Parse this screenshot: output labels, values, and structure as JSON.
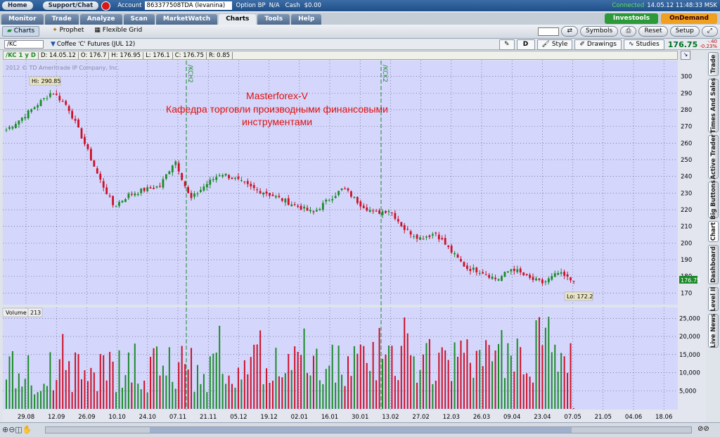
{
  "topbar": {
    "home": "Home",
    "support": "Support/Chat",
    "account_label": "Account",
    "account_value": "863377508TDA (levanina)",
    "option_bp_label": "Option BP",
    "option_bp_value": "N/A",
    "cash_label": "Cash",
    "cash_value": "$0.00",
    "connection_status": "Connected",
    "clock": "14.05.12 11:48:33 MSK"
  },
  "tabs": [
    "Monitor",
    "Trade",
    "Analyze",
    "Scan",
    "MarketWatch",
    "Charts",
    "Tools",
    "Help"
  ],
  "active_tab": "Charts",
  "badges": {
    "investools": "Investools",
    "ondemand": "OnDemand"
  },
  "subbar": {
    "charts": "Charts",
    "prophet": "Prophet",
    "flexible_grid": "Flexible Grid",
    "symbols": "Symbols",
    "reset": "Reset",
    "setup": "Setup"
  },
  "symbol_row": {
    "symbol": "/KC",
    "description": "Coffee 'C' Futures (JUL 12)",
    "d_button": "D",
    "style": "Style",
    "drawings": "Drawings",
    "studies": "Studies",
    "last_price": "176.75",
    "change": "-.40",
    "change_pct": "-0.23%"
  },
  "info_row": {
    "symbol": "/KC 1 y D",
    "date": "D: 14.05.12",
    "open": "O: 176.7",
    "high": "H: 176.95",
    "low": "L: 176.1",
    "close": "C: 176.75",
    "range": "R: 0.85"
  },
  "sidebar_tabs": [
    "Trade",
    "Times And Sales",
    "Active Trader",
    "Big Buttons",
    "Chart",
    "Dashboard",
    "Level II",
    "Live News"
  ],
  "colors": {
    "up": "#1c8a2a",
    "down": "#cc1028",
    "bg": "#d4d7fb",
    "grid": "#4a4a70"
  },
  "chart_data": {
    "type": "candlestick",
    "watermark": "2012 © TD Ameritrade IP Company, Inc.",
    "annotation": [
      "Masterforex-V",
      "Кафедра торговли производными финансовыми",
      "инструментами"
    ],
    "hi_label": "Hi: 290.85",
    "lo_label": "Lo: 172.2",
    "last_label": "176.75",
    "contract_markers": [
      "/KCH2",
      "/KCK2"
    ],
    "ylim": [
      163,
      307
    ],
    "y_ticks": [
      170,
      180,
      190,
      200,
      210,
      220,
      230,
      240,
      250,
      260,
      270,
      280,
      290,
      300
    ],
    "x_labels": [
      "29.08",
      "12.09",
      "26.09",
      "10.10",
      "24.10",
      "07.11",
      "21.11",
      "05.12",
      "19.12",
      "02.01",
      "16.01",
      "30.01",
      "13.02",
      "27.02",
      "12.03",
      "26.03",
      "09.04",
      "23.04",
      "07.05",
      "21.05",
      "04.06",
      "18.06"
    ],
    "price_anchors": [
      268,
      275,
      283,
      290.85,
      282,
      262,
      240,
      222,
      229,
      232,
      234,
      250,
      226,
      235,
      242,
      238,
      233,
      230,
      226,
      222,
      218,
      226,
      233,
      224,
      218,
      220,
      208,
      203,
      206,
      195,
      185,
      183,
      178,
      185,
      179,
      176,
      182,
      176.75
    ],
    "volume_label": "Volume",
    "volume_value": "213",
    "volume_ylim": [
      0,
      27000
    ],
    "volume_ticks": [
      "5,000",
      "10,000",
      "15,000",
      "20,000",
      "25,000"
    ],
    "volume_tick_values": [
      5000,
      10000,
      15000,
      20000,
      25000
    ]
  }
}
